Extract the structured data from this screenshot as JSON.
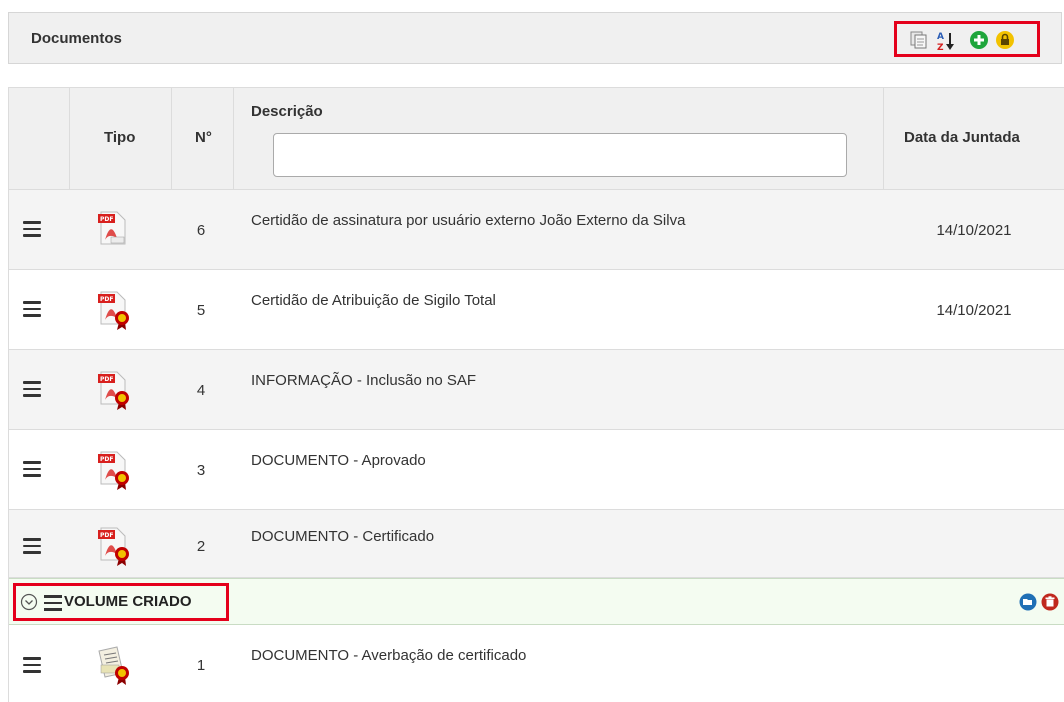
{
  "panel": {
    "title": "Documentos",
    "toolbar_icons": [
      "copy-documents-icon",
      "sort-alpha-icon",
      "add-icon",
      "lock-icon"
    ],
    "toolbar_colors": {
      "add": "#1ea53b",
      "lock": "#f2c200",
      "highlight": "#e4001b"
    }
  },
  "grid": {
    "headers": {
      "tipo": "Tipo",
      "numero": "N°",
      "descricao": "Descrição",
      "data": "Data da Juntada"
    },
    "filter": {
      "value": "",
      "placeholder": ""
    },
    "rows": [
      {
        "numero": "6",
        "descricao": "Certidão de assinatura por usuário externo João Externo da Silva",
        "data": "14/10/2021",
        "icon": "pdf-icon"
      },
      {
        "numero": "5",
        "descricao": "Certidão de Atribuição de Sigilo Total",
        "data": "14/10/2021",
        "icon": "pdf-certified-icon"
      },
      {
        "numero": "4",
        "descricao": "INFORMAÇÃO - Inclusão no SAF",
        "data": "",
        "icon": "pdf-certified-icon"
      },
      {
        "numero": "3",
        "descricao": "DOCUMENTO - Aprovado",
        "data": "",
        "icon": "pdf-certified-icon"
      },
      {
        "numero": "2",
        "descricao": "DOCUMENTO - Certificado",
        "data": "",
        "icon": "pdf-certified-icon"
      }
    ],
    "volume": {
      "label": "VOLUME CRIADO",
      "icons": [
        "collapse-icon",
        "menu-icon",
        "open-folder-icon",
        "delete-icon"
      ]
    },
    "last_row": {
      "numero": "1",
      "descricao": "DOCUMENTO - Averbação de certificado",
      "data": "",
      "icon": "document-certified-icon"
    }
  }
}
